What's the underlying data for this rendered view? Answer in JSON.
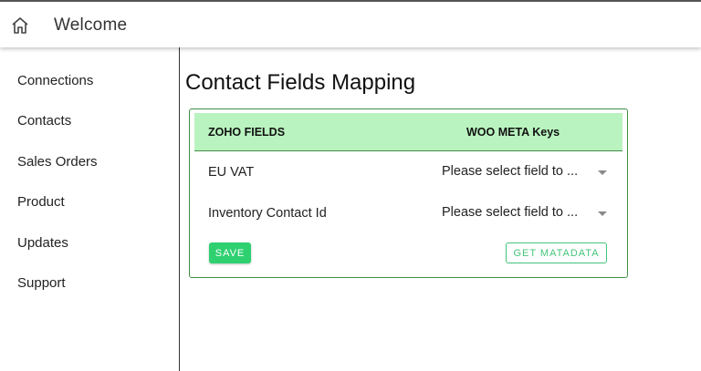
{
  "header": {
    "title": "Welcome",
    "home_icon": "home-icon"
  },
  "sidebar": {
    "items": [
      {
        "label": "Connections"
      },
      {
        "label": "Contacts"
      },
      {
        "label": "Sales Orders"
      },
      {
        "label": "Product"
      },
      {
        "label": "Updates"
      },
      {
        "label": "Support"
      }
    ]
  },
  "main": {
    "title": "Contact Fields Mapping",
    "table": {
      "columns": [
        "ZOHO FIELDS",
        "WOO META Keys"
      ],
      "rows": [
        {
          "field": "EU VAT",
          "select_value": "Please select field to ..."
        },
        {
          "field": "Inventory Contact Id",
          "select_value": "Please select field to ..."
        }
      ]
    },
    "buttons": {
      "save": "SAVE",
      "get_metadata": "GET MATADATA"
    }
  },
  "colors": {
    "header_bg": "#b9f3bf",
    "card_border": "#3f8f45",
    "save_bg": "#2fd070",
    "outline_accent": "#43c47a"
  }
}
